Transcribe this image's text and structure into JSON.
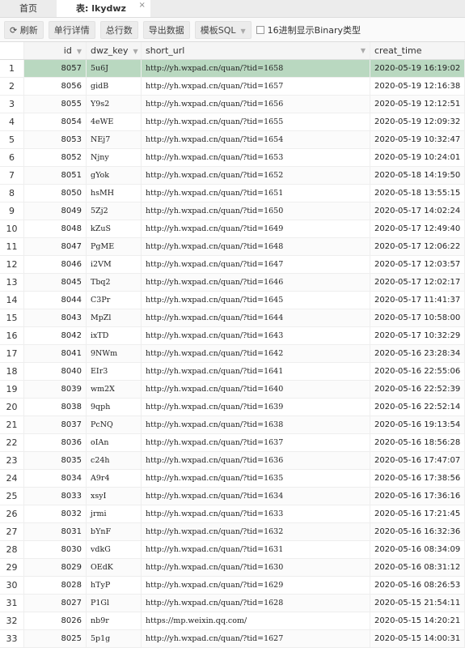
{
  "tabs": [
    {
      "label": "首页"
    },
    {
      "label": "表: lkydwz",
      "close": "×"
    }
  ],
  "toolbar": {
    "refresh": "刷新",
    "detail": "单行详情",
    "count": "总行数",
    "export": "导出数据",
    "template": "模板SQL",
    "hex": "16进制显示Binary类型"
  },
  "columns": [
    "id",
    "dwz_key",
    "short_url",
    "creat_time"
  ],
  "accent": "#b9d8c0",
  "rows": [
    [
      "1",
      "8057",
      "5u6J",
      "http://yh.wxpad.cn/quan/?tid=1658",
      "2020-05-19 16:19:02"
    ],
    [
      "2",
      "8056",
      "gidB",
      "http://yh.wxpad.cn/quan/?tid=1657",
      "2020-05-19 12:16:38"
    ],
    [
      "3",
      "8055",
      "Y9s2",
      "http://yh.wxpad.cn/quan/?tid=1656",
      "2020-05-19 12:12:51"
    ],
    [
      "4",
      "8054",
      "4eWE",
      "http://yh.wxpad.cn/quan/?tid=1655",
      "2020-05-19 12:09:32"
    ],
    [
      "5",
      "8053",
      "NEj7",
      "http://yh.wxpad.cn/quan/?tid=1654",
      "2020-05-19 10:32:47"
    ],
    [
      "6",
      "8052",
      "Njny",
      "http://yh.wxpad.cn/quan/?tid=1653",
      "2020-05-19 10:24:01"
    ],
    [
      "7",
      "8051",
      "gYok",
      "http://yh.wxpad.cn/quan/?tid=1652",
      "2020-05-18 14:19:50"
    ],
    [
      "8",
      "8050",
      "hsMH",
      "http://yh.wxpad.cn/quan/?tid=1651",
      "2020-05-18 13:55:15"
    ],
    [
      "9",
      "8049",
      "5Zj2",
      "http://yh.wxpad.cn/quan/?tid=1650",
      "2020-05-17 14:02:24"
    ],
    [
      "10",
      "8048",
      "kZuS",
      "http://yh.wxpad.cn/quan/?tid=1649",
      "2020-05-17 12:49:40"
    ],
    [
      "11",
      "8047",
      "PgME",
      "http://yh.wxpad.cn/quan/?tid=1648",
      "2020-05-17 12:06:22"
    ],
    [
      "12",
      "8046",
      "i2VM",
      "http://yh.wxpad.cn/quan/?tid=1647",
      "2020-05-17 12:03:57"
    ],
    [
      "13",
      "8045",
      "Tbq2",
      "http://yh.wxpad.cn/quan/?tid=1646",
      "2020-05-17 12:02:17"
    ],
    [
      "14",
      "8044",
      "C3Pr",
      "http://yh.wxpad.cn/quan/?tid=1645",
      "2020-05-17 11:41:37"
    ],
    [
      "15",
      "8043",
      "MpZl",
      "http://yh.wxpad.cn/quan/?tid=1644",
      "2020-05-17 10:58:00"
    ],
    [
      "16",
      "8042",
      "ixTD",
      "http://yh.wxpad.cn/quan/?tid=1643",
      "2020-05-17 10:32:29"
    ],
    [
      "17",
      "8041",
      "9NWm",
      "http://yh.wxpad.cn/quan/?tid=1642",
      "2020-05-16 23:28:34"
    ],
    [
      "18",
      "8040",
      "EIr3",
      "http://yh.wxpad.cn/quan/?tid=1641",
      "2020-05-16 22:55:06"
    ],
    [
      "19",
      "8039",
      "wm2X",
      "http://yh.wxpad.cn/quan/?tid=1640",
      "2020-05-16 22:52:39"
    ],
    [
      "20",
      "8038",
      "9qph",
      "http://yh.wxpad.cn/quan/?tid=1639",
      "2020-05-16 22:52:14"
    ],
    [
      "21",
      "8037",
      "PcNQ",
      "http://yh.wxpad.cn/quan/?tid=1638",
      "2020-05-16 19:13:54"
    ],
    [
      "22",
      "8036",
      "oIAn",
      "http://yh.wxpad.cn/quan/?tid=1637",
      "2020-05-16 18:56:28"
    ],
    [
      "23",
      "8035",
      "c24h",
      "http://yh.wxpad.cn/quan/?tid=1636",
      "2020-05-16 17:47:07"
    ],
    [
      "24",
      "8034",
      "A9r4",
      "http://yh.wxpad.cn/quan/?tid=1635",
      "2020-05-16 17:38:56"
    ],
    [
      "25",
      "8033",
      "xsyI",
      "http://yh.wxpad.cn/quan/?tid=1634",
      "2020-05-16 17:36:16"
    ],
    [
      "26",
      "8032",
      "jrmi",
      "http://yh.wxpad.cn/quan/?tid=1633",
      "2020-05-16 17:21:45"
    ],
    [
      "27",
      "8031",
      "bYnF",
      "http://yh.wxpad.cn/quan/?tid=1632",
      "2020-05-16 16:32:36"
    ],
    [
      "28",
      "8030",
      "vdkG",
      "http://yh.wxpad.cn/quan/?tid=1631",
      "2020-05-16 08:34:09"
    ],
    [
      "29",
      "8029",
      "OEdK",
      "http://yh.wxpad.cn/quan/?tid=1630",
      "2020-05-16 08:31:12"
    ],
    [
      "30",
      "8028",
      "hTyP",
      "http://yh.wxpad.cn/quan/?tid=1629",
      "2020-05-16 08:26:53"
    ],
    [
      "31",
      "8027",
      "P1Gl",
      "http://yh.wxpad.cn/quan/?tid=1628",
      "2020-05-15 21:54:11"
    ],
    [
      "32",
      "8026",
      "nb9r",
      "https://mp.weixin.qq.com/",
      "2020-05-15 14:20:21"
    ],
    [
      "33",
      "8025",
      "5p1g",
      "http://yh.wxpad.cn/quan/?tid=1627",
      "2020-05-15 14:00:31"
    ]
  ]
}
